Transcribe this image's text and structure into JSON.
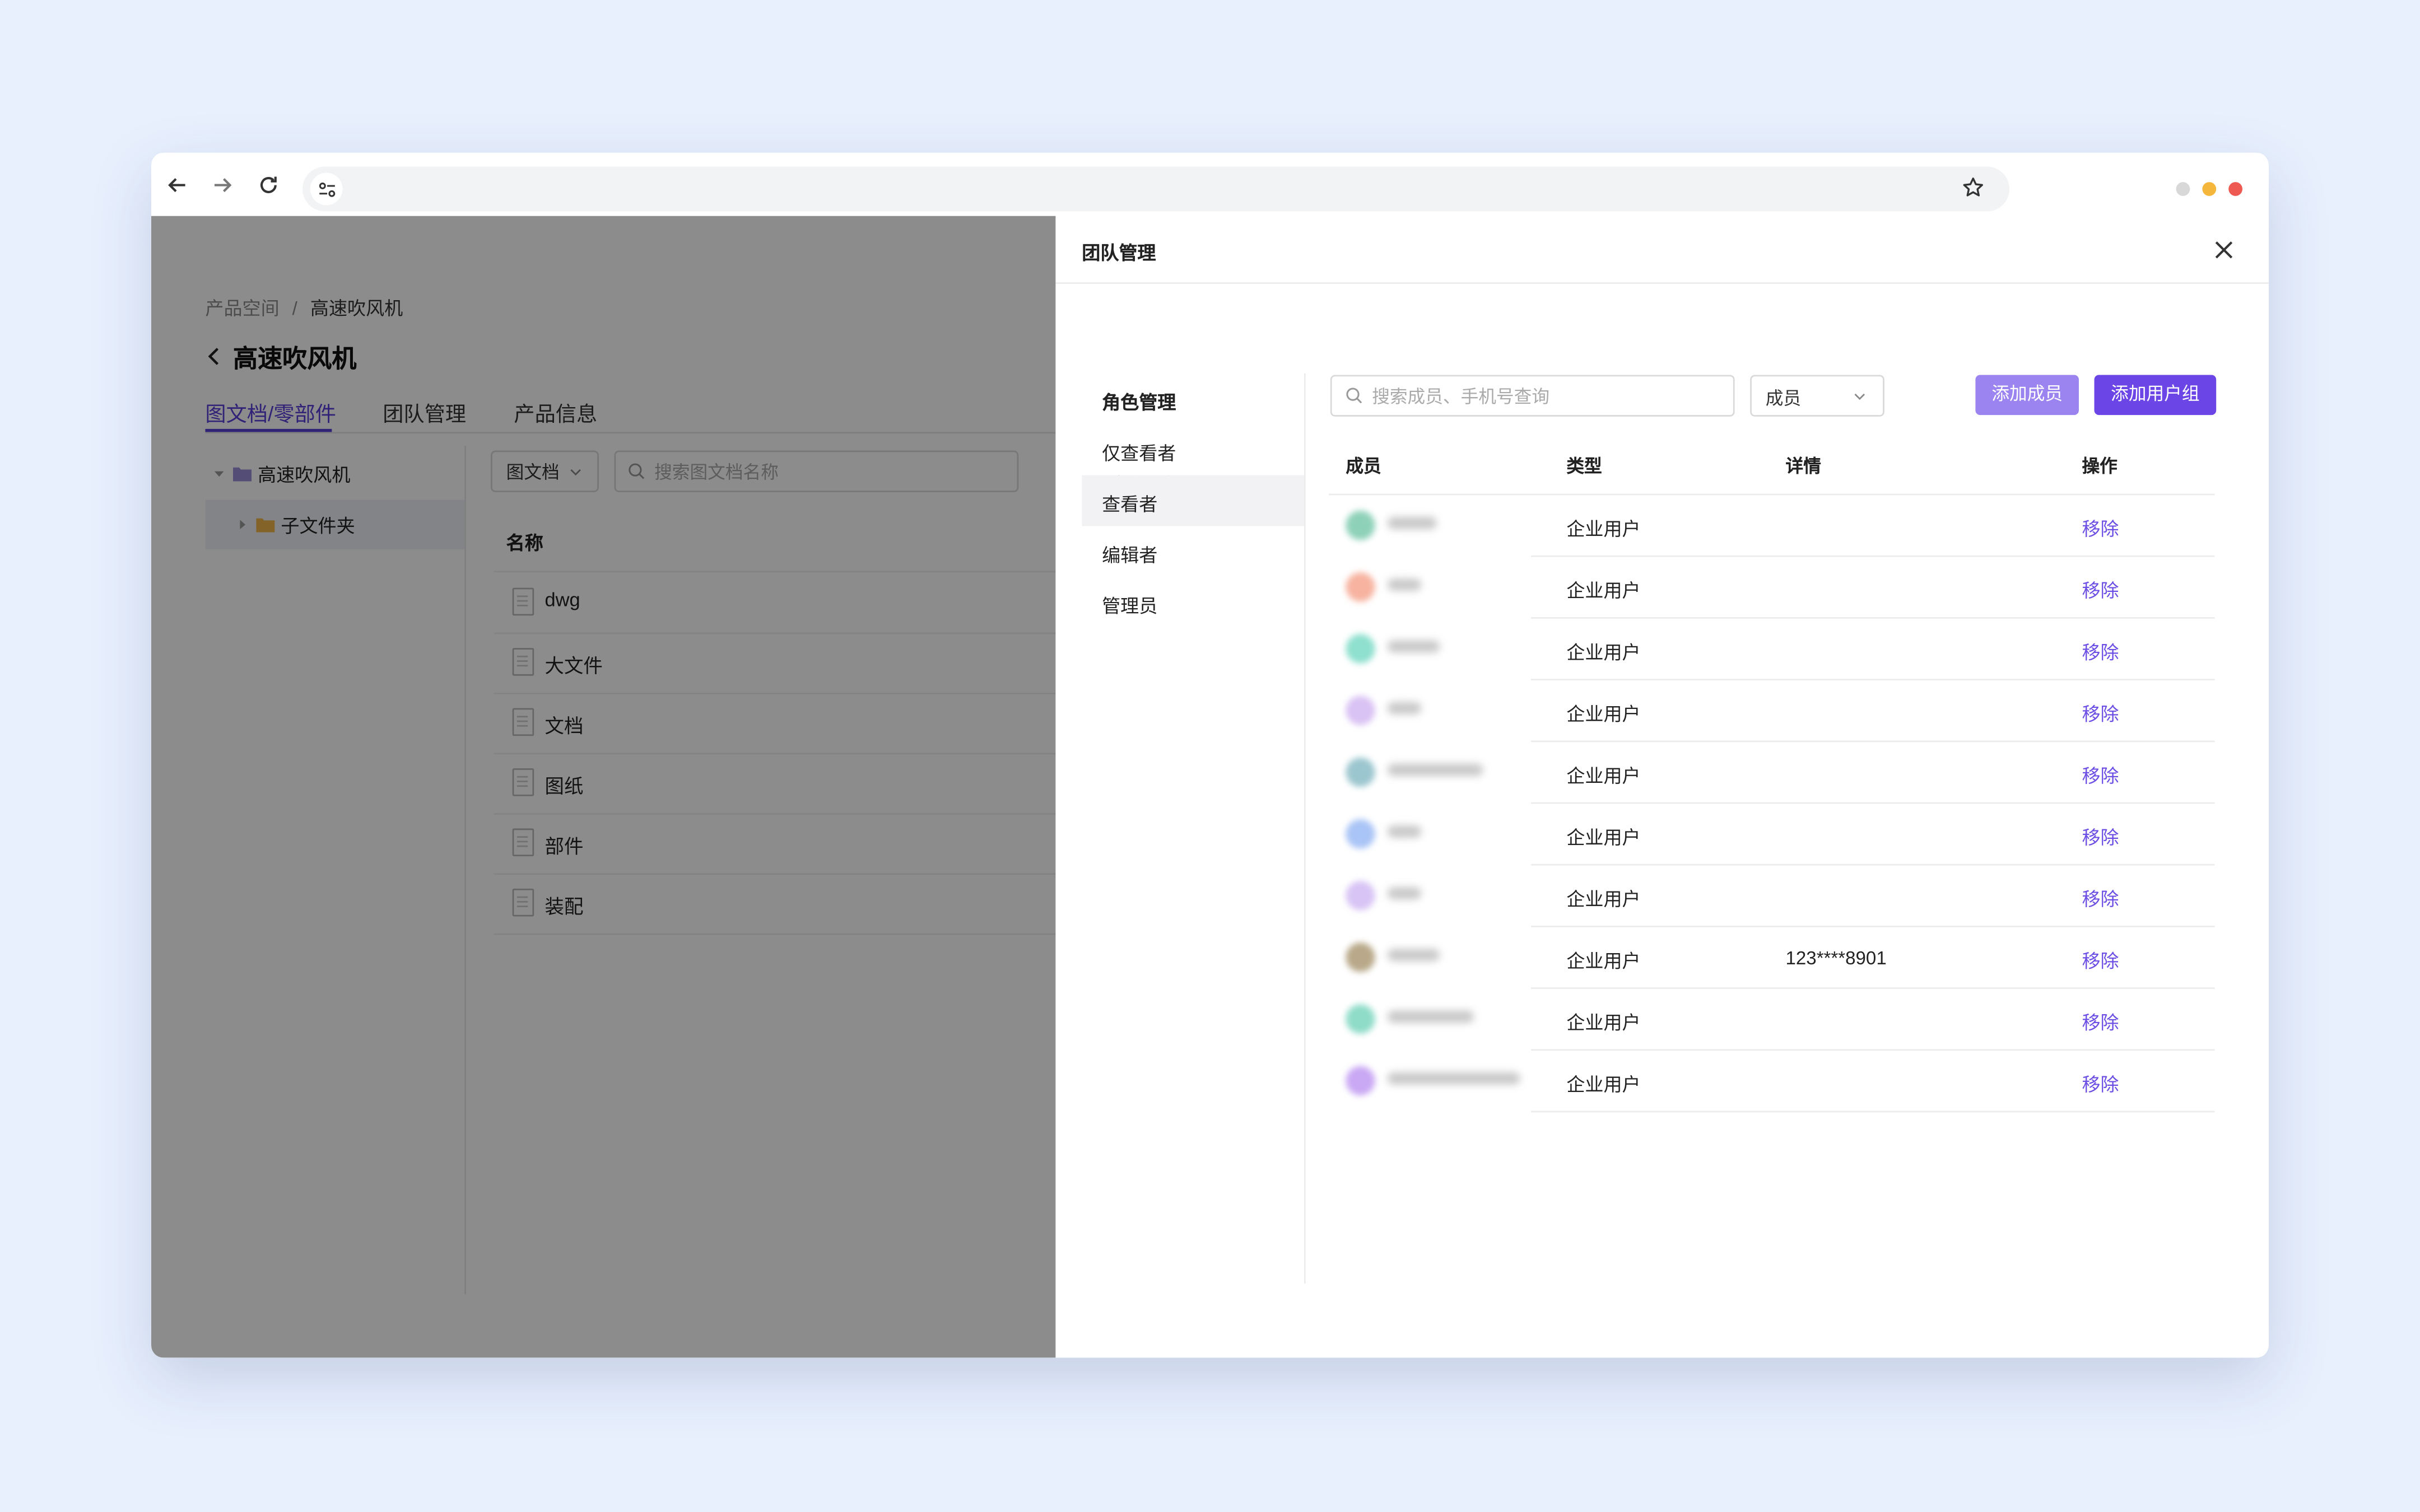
{
  "browser": {
    "icons": {
      "back": "arrow-left-icon",
      "forward": "arrow-right-icon",
      "reload": "reload-icon",
      "site_info": "tune-icon",
      "bookmark": "star-icon"
    },
    "window_dots": [
      "#d8d8d8",
      "#f5b73b",
      "#ee5a52"
    ]
  },
  "app": {
    "breadcrumb": {
      "root": "产品空间",
      "separator": "/",
      "current": "高速吹风机"
    },
    "title": "高速吹风机",
    "tabs": [
      {
        "label": "图文档/零部件",
        "active": true
      },
      {
        "label": "团队管理",
        "active": false
      },
      {
        "label": "产品信息",
        "active": false
      }
    ],
    "tree": [
      {
        "label": "高速吹风机",
        "expanded": true
      },
      {
        "label": "子文件夹",
        "selected": true
      }
    ],
    "filter": {
      "label": "图文档"
    },
    "search": {
      "placeholder": "搜索图文档名称"
    },
    "table_header": "名称",
    "files": [
      "dwg",
      "大文件",
      "文档",
      "图纸",
      "部件",
      "装配"
    ]
  },
  "drawer": {
    "title": "团队管理",
    "folder_name": "子文件夹",
    "roles": [
      {
        "label": "角色管理",
        "bold": true
      },
      {
        "label": "仅查看者"
      },
      {
        "label": "查看者",
        "selected": true
      },
      {
        "label": "编辑者"
      },
      {
        "label": "管理员"
      }
    ],
    "search": {
      "placeholder": "搜索成员、手机号查询"
    },
    "member_select": {
      "value": "成员"
    },
    "buttons": {
      "add_member": "添加成员",
      "add_group": "添加用户组"
    },
    "colors": {
      "add_member": "#9b84f0",
      "add_group": "#6b45e6",
      "link": "#6c4ee4"
    },
    "columns": {
      "member": "成员",
      "type": "类型",
      "details": "详情",
      "action": "操作"
    },
    "members": [
      {
        "avatar_color": "#8ed1b9",
        "type": "企业用户",
        "details": "",
        "action": "移除"
      },
      {
        "avatar_color": "#f7b3a0",
        "type": "企业用户",
        "details": "",
        "action": "移除"
      },
      {
        "avatar_color": "#8fe0cf",
        "type": "企业用户",
        "details": "",
        "action": "移除"
      },
      {
        "avatar_color": "#d9c2f4",
        "type": "企业用户",
        "details": "",
        "action": "移除"
      },
      {
        "avatar_color": "#9cc6cf",
        "type": "企业用户",
        "details": "",
        "action": "移除"
      },
      {
        "avatar_color": "#a9c4f6",
        "type": "企业用户",
        "details": "",
        "action": "移除"
      },
      {
        "avatar_color": "#d8c4f5",
        "type": "企业用户",
        "details": "",
        "action": "移除"
      },
      {
        "avatar_color": "#b9a98a",
        "type": "企业用户",
        "details": "123****8901",
        "action": "移除"
      },
      {
        "avatar_color": "#8fdcc8",
        "type": "企业用户",
        "details": "",
        "action": "移除"
      },
      {
        "avatar_color": "#c9a8f4",
        "type": "企业用户",
        "details": "",
        "action": "移除"
      }
    ]
  }
}
